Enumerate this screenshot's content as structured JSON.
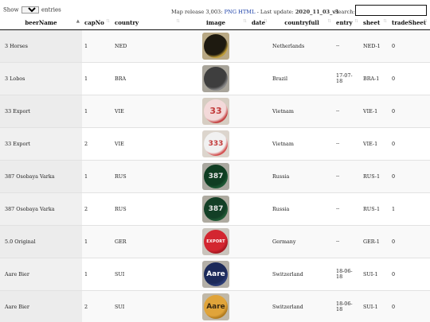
{
  "controls": {
    "show_label": "Show",
    "entries_value": "10",
    "entries_label": "entries",
    "release_prefix": "Map release 3,003:",
    "release_link": "PNG HTML",
    "release_sep": " - Last update:",
    "last_update": "2020_11_03_v1",
    "search_label": "Search:",
    "search_value": ""
  },
  "columns": [
    "beerName",
    "capNo",
    "country",
    "image",
    "date",
    "countryfull",
    "entry",
    "sheet",
    "tradeSheet"
  ],
  "rows": [
    {
      "beerName": "3 Horses",
      "capNo": "1",
      "country": "NED",
      "date": "",
      "countryfull": "Netherlands",
      "entry": "--",
      "sheet": "NED-1",
      "tradeSheet": "0",
      "cap": {
        "bg": "#b8a884",
        "disc": "#1e1a10",
        "ring": "#c9a53a",
        "text": "",
        "text_color": "#c9a53a"
      }
    },
    {
      "beerName": "3 Lobos",
      "capNo": "1",
      "country": "BRA",
      "date": "",
      "countryfull": "Brazil",
      "entry": "17-07-18",
      "sheet": "BRA-1",
      "tradeSheet": "0",
      "cap": {
        "bg": "#a8a49a",
        "disc": "#3e3e3e",
        "ring": "#8c8c8c",
        "text": "",
        "text_color": "#bbbbbb"
      }
    },
    {
      "beerName": "33 Export",
      "capNo": "1",
      "country": "VIE",
      "date": "",
      "countryfull": "Vietnam",
      "entry": "--",
      "sheet": "VIE-1",
      "tradeSheet": "0",
      "cap": {
        "bg": "#d6cdc2",
        "disc": "#f3d9d9",
        "ring": "#c23a3a",
        "text": "33",
        "text_color": "#c23a3a"
      }
    },
    {
      "beerName": "33 Export",
      "capNo": "2",
      "country": "VIE",
      "date": "",
      "countryfull": "Vietnam",
      "entry": "--",
      "sheet": "VIE-1",
      "tradeSheet": "0",
      "cap": {
        "bg": "#dcd5cd",
        "disc": "#f1f1f1",
        "ring": "#d24848",
        "text": "333",
        "text_color": "#c23a3a"
      }
    },
    {
      "beerName": "387 Osobaya Varka",
      "capNo": "1",
      "country": "RUS",
      "date": "",
      "countryfull": "Russia",
      "entry": "--",
      "sheet": "RUS-1",
      "tradeSheet": "0",
      "cap": {
        "bg": "#a9a79f",
        "disc": "#0f3d22",
        "ring": "#1e5a35",
        "text": "387",
        "text_color": "#e6e6e6"
      }
    },
    {
      "beerName": "387 Osobaya Varka",
      "capNo": "2",
      "country": "RUS",
      "date": "",
      "countryfull": "Russia",
      "entry": "--",
      "sheet": "RUS-1",
      "tradeSheet": "1",
      "cap": {
        "bg": "#aeaaa0",
        "disc": "#133f26",
        "ring": "#215c37",
        "text": "387",
        "text_color": "#e6e6e6"
      }
    },
    {
      "beerName": "5.0 Original",
      "capNo": "1",
      "country": "GER",
      "date": "",
      "countryfull": "Germany",
      "entry": "--",
      "sheet": "GER-1",
      "tradeSheet": "0",
      "cap": {
        "bg": "#c9c3bb",
        "disc": "#d32630",
        "ring": "#a51a22",
        "text": "EXPORT",
        "text_color": "#ffffff"
      }
    },
    {
      "beerName": "Aare Bier",
      "capNo": "1",
      "country": "SUI",
      "date": "",
      "countryfull": "Switzerland",
      "entry": "18-06-18",
      "sheet": "SUI-1",
      "tradeSheet": "0",
      "cap": {
        "bg": "#b4b0a8",
        "disc": "#1c2a5a",
        "ring": "#2c3d78",
        "text": "Aare",
        "text_color": "#ffffff"
      }
    },
    {
      "beerName": "Aare Bier",
      "capNo": "2",
      "country": "SUI",
      "date": "",
      "countryfull": "Switzerland",
      "entry": "18-06-18",
      "sheet": "SUI-1",
      "tradeSheet": "0",
      "cap": {
        "bg": "#c0b8a8",
        "disc": "#e0a43a",
        "ring": "#b07a1e",
        "text": "Aare",
        "text_color": "#3a2a12"
      }
    }
  ]
}
